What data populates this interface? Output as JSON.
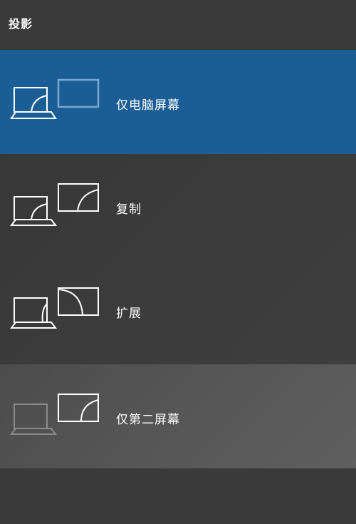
{
  "title": "投影",
  "options": [
    {
      "label": "仅电脑屏幕",
      "icon": "pc-screen-only-icon",
      "state": "selected"
    },
    {
      "label": "复制",
      "icon": "duplicate-icon",
      "state": "normal"
    },
    {
      "label": "扩展",
      "icon": "extend-icon",
      "state": "normal"
    },
    {
      "label": "仅第二屏幕",
      "icon": "second-screen-only-icon",
      "state": "hover"
    }
  ],
  "colors": {
    "selected": "#1b5e96",
    "background": "#3a3a3a",
    "hover": "#555555"
  }
}
